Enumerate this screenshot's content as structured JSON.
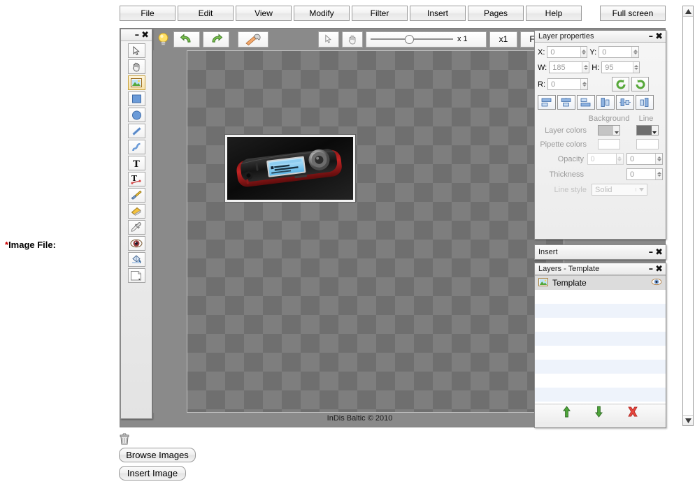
{
  "menubar": {
    "items": [
      {
        "label": "File",
        "name": "menu-file"
      },
      {
        "label": "Edit",
        "name": "menu-edit"
      },
      {
        "label": "View",
        "name": "menu-view"
      },
      {
        "label": "Modify",
        "name": "menu-modify"
      },
      {
        "label": "Filter",
        "name": "menu-filter"
      },
      {
        "label": "Insert",
        "name": "menu-insert"
      },
      {
        "label": "Pages",
        "name": "menu-pages"
      },
      {
        "label": "Help",
        "name": "menu-help"
      }
    ],
    "fullscreen": "Full screen"
  },
  "toolbox": {
    "title": "",
    "minimize": "–",
    "close": "✖",
    "tools": [
      {
        "icon": "pointer-icon",
        "selected": false
      },
      {
        "icon": "hand-icon",
        "selected": false
      },
      {
        "icon": "image-icon",
        "selected": true
      },
      {
        "icon": "rectangle-icon",
        "selected": false
      },
      {
        "icon": "ellipse-icon",
        "selected": false
      },
      {
        "icon": "line-icon",
        "selected": false
      },
      {
        "icon": "curve-icon",
        "selected": false
      },
      {
        "icon": "text-icon",
        "selected": false
      },
      {
        "icon": "text-path-icon",
        "selected": false
      },
      {
        "icon": "brush-icon",
        "selected": false
      },
      {
        "icon": "eraser-icon",
        "selected": false
      },
      {
        "icon": "pipette-icon",
        "selected": false
      },
      {
        "icon": "eye-icon",
        "selected": false
      },
      {
        "icon": "fill-bucket-icon",
        "selected": false
      },
      {
        "icon": "page-icon",
        "selected": false
      }
    ]
  },
  "canvas_toolbar": {
    "hint_bulb": "bulb-icon",
    "undo": "undo-icon",
    "redo": "redo-icon",
    "settings": "screwdriver-wrench-icon",
    "select_tool": "pointer-icon",
    "pan_tool": "hand-icon",
    "zoom_label": "x 1",
    "zoom_value": 1,
    "zoom_reset": "x1",
    "zoom_fit": "Fit",
    "right_bulb": "bulb-icon"
  },
  "canvas": {
    "credit": "InDis Baltic © 2010",
    "photo_alt": "mp3-player-photo"
  },
  "layer_properties": {
    "title": "Layer properties",
    "minimize": "–",
    "close": "✖",
    "fields": [
      {
        "label": "X:",
        "value": "0",
        "name": "layer-x-input"
      },
      {
        "label": "Y:",
        "value": "0",
        "name": "layer-y-input"
      },
      {
        "label": "W:",
        "value": "185",
        "name": "layer-w-input"
      },
      {
        "label": "H:",
        "value": "95",
        "name": "layer-h-input"
      },
      {
        "label": "R:",
        "value": "0",
        "name": "layer-r-input"
      }
    ],
    "rotate_left": "rotate-left-icon",
    "rotate_right": "rotate-right-icon",
    "align_buttons": [
      "align-top-icon",
      "align-middle-icon",
      "align-bottom-icon",
      "align-left-icon",
      "align-center-icon",
      "align-right-icon"
    ],
    "col_background": "Background",
    "col_line": "Line",
    "row_layer_colors": "Layer colors",
    "row_pipette_colors": "Pipette colors",
    "row_opacity": "Opacity",
    "row_thickness": "Thickness",
    "row_line_style": "Line style",
    "opacity_background": "0",
    "opacity_line": "0",
    "thickness_line": "0",
    "line_style_value": "Solid",
    "color_background_hex": "#c4c4c4",
    "color_line_hex": "#6e6e6e"
  },
  "insert_panel": {
    "title": "Insert",
    "minimize": "–",
    "close": "✖"
  },
  "layers_panel": {
    "title": "Layers - Template",
    "minimize": "–",
    "close": "✖",
    "rows": [
      {
        "name": "Template",
        "icon": "image-icon",
        "visible_icon": "eye-icon",
        "selected": true
      }
    ],
    "empty_row_count": 8,
    "move_up": "arrow-up-icon",
    "move_down": "arrow-down-icon",
    "delete": "delete-x-icon"
  },
  "form": {
    "required_marker": "*",
    "image_file_label": "Image File:",
    "trash_icon": "trash-icon",
    "browse_button": "Browse Images",
    "insert_button": "Insert Image"
  },
  "scrollbar": {
    "up": "scroll-up-icon",
    "down": "scroll-down-icon"
  }
}
